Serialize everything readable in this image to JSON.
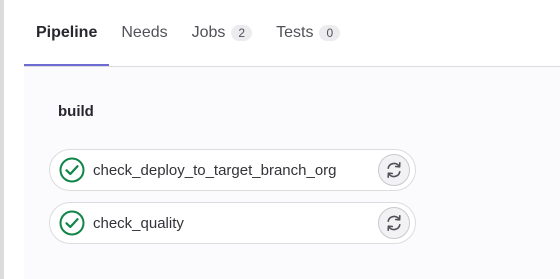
{
  "tabs": [
    {
      "label": "Pipeline",
      "active": true
    },
    {
      "label": "Needs"
    },
    {
      "label": "Jobs",
      "count": "2"
    },
    {
      "label": "Tests",
      "count": "0"
    }
  ],
  "stage": {
    "title": "build",
    "jobs": [
      {
        "name": "check_deploy_to_target_branch_org",
        "status": "success",
        "status_icon": "check-circle-icon",
        "action_icon": "retry-icon"
      },
      {
        "name": "check_quality",
        "status": "success",
        "status_icon": "check-circle-icon",
        "action_icon": "retry-icon"
      }
    ]
  },
  "colors": {
    "success": "#108548",
    "active_tab_underline": "#6b6bd3",
    "border": "#dcdcde"
  }
}
